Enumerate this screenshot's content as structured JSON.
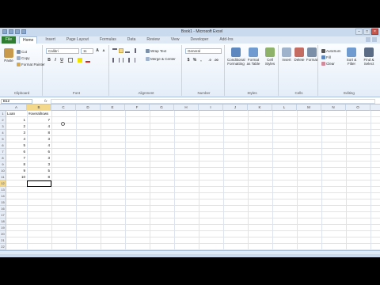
{
  "window": {
    "title": "Book1 - Microsoft Excel"
  },
  "tabs": {
    "file": "File",
    "items": [
      "Home",
      "Insert",
      "Page Layout",
      "Formulas",
      "Data",
      "Review",
      "View",
      "Developer",
      "Add-Ins"
    ]
  },
  "ribbon": {
    "clipboard": {
      "paste": "Paste",
      "cut": "Cut",
      "copy": "Copy",
      "format_painter": "Format Painter",
      "label": "Clipboard"
    },
    "font": {
      "name": "Calibri",
      "size": "11",
      "label": "Font",
      "bold": "B",
      "italic": "I",
      "underline": "U"
    },
    "alignment": {
      "wrap": "Wrap Text",
      "merge": "Merge & Center",
      "label": "Alignment"
    },
    "number": {
      "format": "General",
      "label": "Number"
    },
    "styles": {
      "conditional": "Conditional Formatting",
      "format_table": "Format as Table",
      "cell_styles": "Cell Styles",
      "label": "Styles"
    },
    "cells": {
      "insert": "Insert",
      "delete": "Delete",
      "format": "Format",
      "label": "Cells"
    },
    "editing": {
      "autosum": "AutoSum",
      "fill": "Fill",
      "clear": "Clear",
      "sort": "Sort & Filter",
      "find": "Find & Select",
      "label": "Editing"
    }
  },
  "formula_bar": {
    "name_box": "B12",
    "fx": "fx",
    "value": ""
  },
  "columns": [
    "A",
    "B",
    "C",
    "D",
    "E",
    "F",
    "G",
    "H",
    "I",
    "J",
    "K",
    "L",
    "M",
    "N",
    "O"
  ],
  "rows": [
    "1",
    "2",
    "3",
    "4",
    "5",
    "6",
    "7",
    "8",
    "9",
    "10",
    "11",
    "12",
    "13",
    "14",
    "15",
    "16",
    "17",
    "18",
    "19",
    "20",
    "21",
    "22"
  ],
  "sheet": {
    "headers": {
      "a1": "Loan",
      "b1": "#overallrows"
    },
    "values": [
      {
        "a": "1",
        "b": "7"
      },
      {
        "a": "2",
        "b": "4"
      },
      {
        "a": "3",
        "b": "8"
      },
      {
        "a": "4",
        "b": "3"
      },
      {
        "a": "5",
        "b": "4"
      },
      {
        "a": "6",
        "b": "6"
      },
      {
        "a": "7",
        "b": "3"
      },
      {
        "a": "8",
        "b": "3"
      },
      {
        "a": "9",
        "b": "5"
      },
      {
        "a": "10",
        "b": "8"
      }
    ]
  }
}
